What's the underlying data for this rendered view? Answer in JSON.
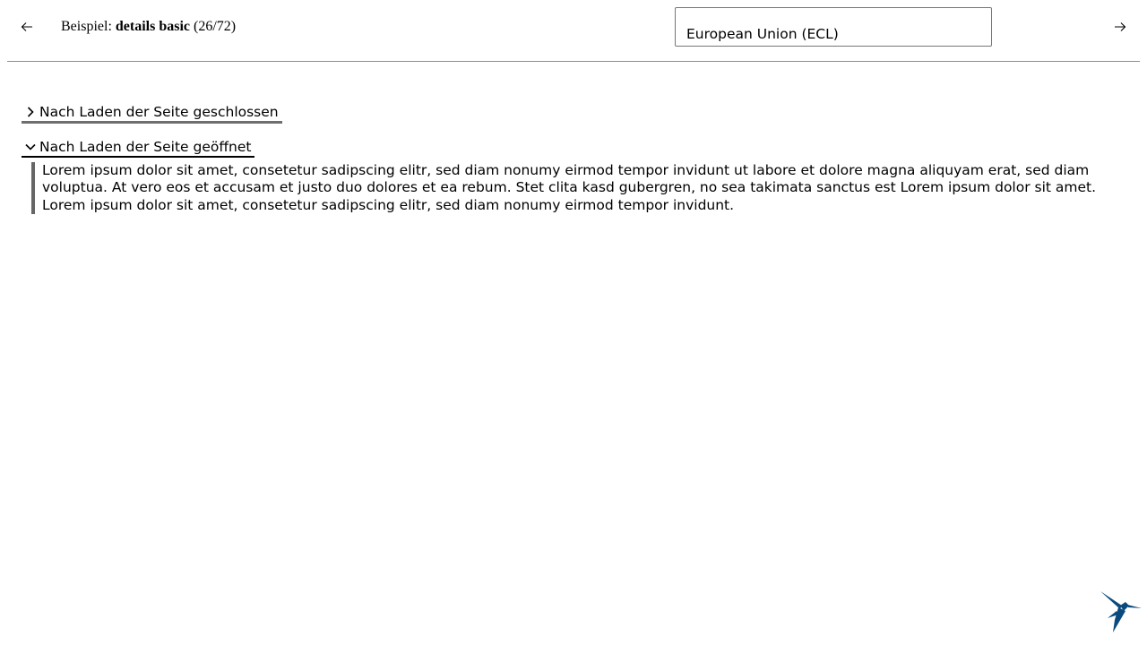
{
  "header": {
    "example_prefix": "Beispiel:",
    "example_name": "details basic",
    "example_counter": "(26/72)",
    "theme_value": "European Union (ECL)"
  },
  "details": [
    {
      "summary": "Nach Laden der Seite geschlossen",
      "open": false
    },
    {
      "summary": "Nach Laden der Seite geöffnet",
      "open": true,
      "body": "Lorem ipsum dolor sit amet, consetetur sadipscing elitr, sed diam nonumy eirmod tempor invidunt ut labore et dolore magna aliquyam erat, sed diam voluptua. At vero eos et accusam et justo duo dolores et ea rebum. Stet clita kasd gubergren, no sea takimata sanctus est Lorem ipsum dolor sit amet. Lorem ipsum dolor sit amet, consetetur sadipscing elitr, sed diam nonumy eirmod tempor invidunt."
    }
  ],
  "icons": {
    "prev": "arrow-left-icon",
    "next": "arrow-right-icon",
    "closed": "chevron-right-icon",
    "open": "chevron-down-icon",
    "logo": "hummingbird-logo-icon"
  },
  "colors": {
    "logo": "#0b4a7e",
    "divider": "#8e8e8e"
  }
}
